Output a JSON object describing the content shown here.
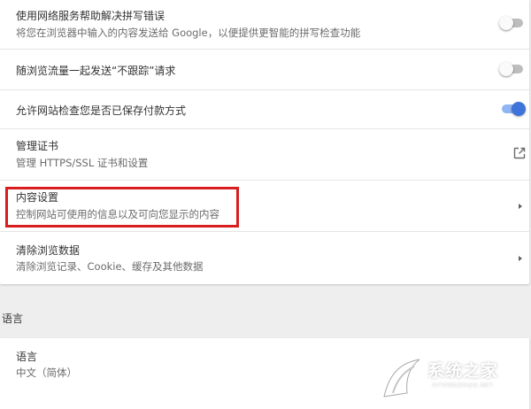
{
  "privacy": {
    "spellcheck": {
      "title": "使用网络服务帮助解决拼写错误",
      "subtitle": "将您在浏览器中输入的内容发送给 Google，以便提供更智能的拼写检查功能",
      "enabled": false
    },
    "do_not_track": {
      "title": "随浏览流量一起发送“不跟踪”请求",
      "enabled": false
    },
    "payment_methods": {
      "title": "允许网站检查您是否已保存付款方式",
      "enabled": true
    },
    "certificates": {
      "title": "管理证书",
      "subtitle": "管理 HTTPS/SSL 证书和设置",
      "icon": "open-in-new-icon"
    },
    "content_settings": {
      "title": "内容设置",
      "subtitle": "控制网站可使用的信息以及可向您显示的内容",
      "highlight_color": "#d81e1e"
    },
    "clear_data": {
      "title": "清除浏览数据",
      "subtitle": "清除浏览记录、Cookie、缓存及其他数据"
    }
  },
  "languages": {
    "section_title": "语言",
    "language_row": {
      "title": "语言",
      "value": "中文（简体）"
    }
  },
  "watermark": {
    "text": "系统之家",
    "url": "XITONGZHIJIA.NET"
  },
  "colors": {
    "toggle_on": "#3e73d9",
    "toggle_off": "#bdbdbd",
    "highlight": "#d81e1e"
  }
}
